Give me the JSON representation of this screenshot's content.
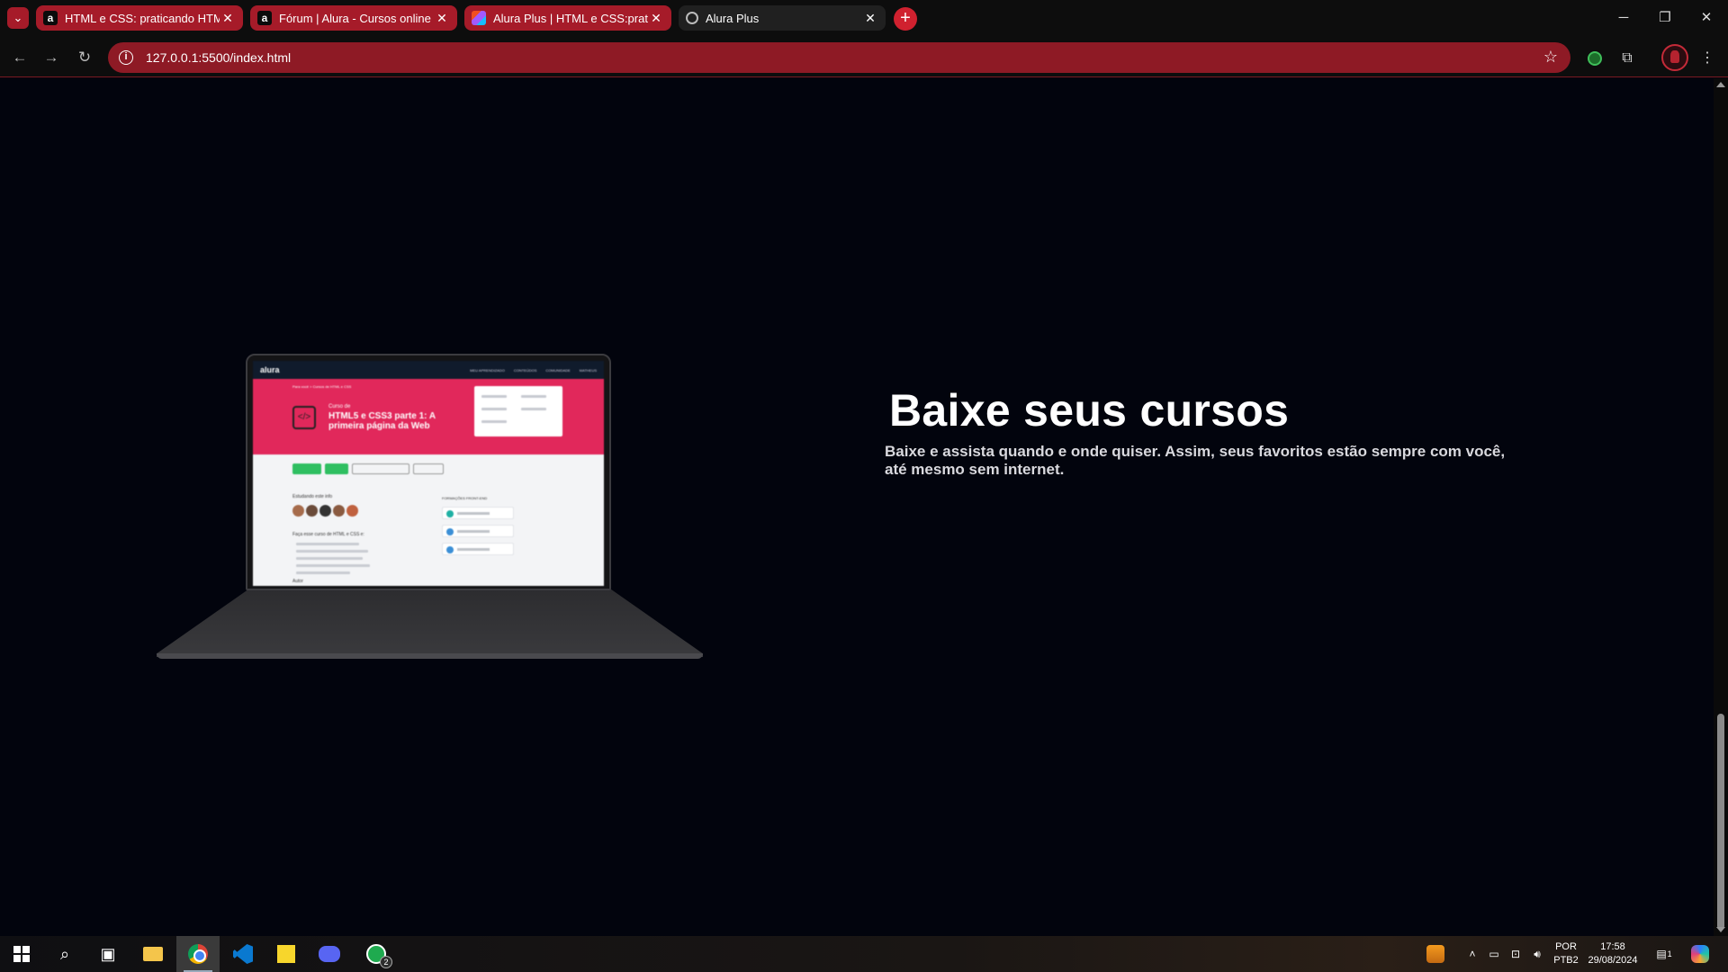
{
  "browser": {
    "tabs": [
      {
        "title": "HTML e CSS: praticando HTML/CSS",
        "favicon": "alura-icon",
        "state": "pinned-group"
      },
      {
        "title": "Fórum | Alura - Cursos online de Tecnologia",
        "favicon": "alura-icon",
        "state": "group"
      },
      {
        "title": "Alura Plus | HTML e CSS:praticando",
        "favicon": "figma-icon",
        "state": "group"
      },
      {
        "title": "Alura Plus",
        "favicon": "globe-icon",
        "state": "active"
      }
    ],
    "new_tab_label": "+",
    "url": "127.0.0.1:5500/index.html",
    "accent_color": "#a61b29"
  },
  "page": {
    "hero_title": "Baixe seus cursos",
    "hero_text": "Baixe e assista quando e onde quiser. Assim, seus favoritos estão sempre com você, até mesmo sem internet.",
    "background_color": "#02040d"
  },
  "laptop_screen": {
    "logo": "alura",
    "nav_items": [
      "MEU APRENDIZADO",
      "CONTEÚDOS",
      "COMUNIDADE",
      "MATHEUS"
    ],
    "breadcrumb": "Para você  >  Cursos de HTML e CSS",
    "course_kicker": "Curso de",
    "course_title": "HTML5 e CSS3 parte 1: A primeira página da Web",
    "studying_label": "Estudando este info",
    "about_label": "Faça esse curso de HTML e CSS e:",
    "author_label": "Autor",
    "formations_label": "FORMAÇÕES FRONT-END"
  },
  "taskbar": {
    "apps": [
      "start",
      "search",
      "task-view",
      "file-explorer",
      "chrome",
      "vscode",
      "sticky-notes",
      "discord",
      "whatsapp"
    ],
    "whatsapp_badge": "2",
    "lang_line1": "POR",
    "lang_line2": "PTB2",
    "time": "17:58",
    "date": "29/08/2024",
    "notifications": "1"
  }
}
